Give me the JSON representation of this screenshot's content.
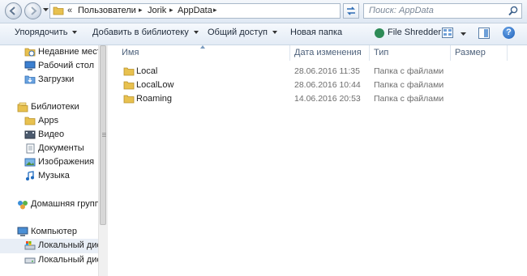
{
  "address_bar": {
    "overflow_chevron": "«",
    "breadcrumbs": [
      "Пользователи",
      "Jorik",
      "AppData"
    ],
    "search_placeholder": "Поиск: AppData"
  },
  "toolbar": {
    "organize_label": "Упорядочить",
    "add_to_library_label": "Добавить в библиотеку",
    "share_label": "Общий доступ",
    "new_folder_label": "Новая папка",
    "file_shredder_label": "File Shredder",
    "help_label": "?"
  },
  "nav_pane": {
    "items": [
      {
        "label": "Недавние места",
        "icon": "recent-places-icon"
      },
      {
        "label": "Рабочий стол",
        "icon": "desktop-icon"
      },
      {
        "label": "Загрузки",
        "icon": "downloads-icon"
      },
      {
        "label": "Библиотеки",
        "icon": "libraries-icon"
      },
      {
        "label": "Apps",
        "icon": "folder-icon"
      },
      {
        "label": "Видео",
        "icon": "video-library-icon"
      },
      {
        "label": "Документы",
        "icon": "documents-library-icon"
      },
      {
        "label": "Изображения",
        "icon": "pictures-library-icon"
      },
      {
        "label": "Музыка",
        "icon": "music-library-icon"
      },
      {
        "label": "Домашняя группа",
        "icon": "homegroup-icon"
      },
      {
        "label": "Компьютер",
        "icon": "computer-icon"
      },
      {
        "label": "Локальный диск",
        "icon": "system-drive-icon"
      },
      {
        "label": "Локальный диск",
        "icon": "drive-icon"
      }
    ]
  },
  "file_list": {
    "columns": [
      "Имя",
      "Дата изменения",
      "Тип",
      "Размер"
    ],
    "rows": [
      {
        "name": "Local",
        "date": "28.06.2016 11:35",
        "type": "Папка с файлами",
        "size": ""
      },
      {
        "name": "LocalLow",
        "date": "28.06.2016 10:44",
        "type": "Папка с файлами",
        "size": ""
      },
      {
        "name": "Roaming",
        "date": "14.06.2016 20:53",
        "type": "Папка с файлами",
        "size": ""
      }
    ]
  },
  "colors": {
    "toolbar_top": "#f6f9fd",
    "toolbar_bottom": "#e3ebf5",
    "folder_yellow": "#e8c14f",
    "header_text": "#4c607a",
    "meta_text": "#6d6d6d"
  }
}
